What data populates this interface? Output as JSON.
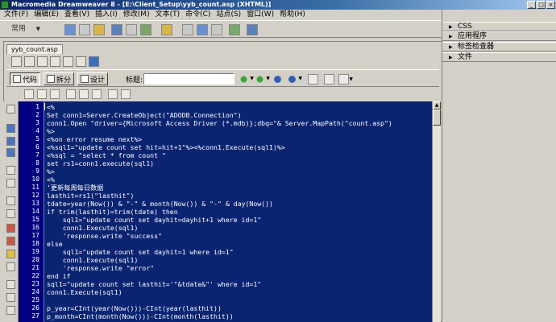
{
  "window": {
    "title": "Macromedia Dreamweaver 8 - [E:\\Client_Setup\\yyb_count.asp (XHTML)]",
    "controls": [
      "_",
      "□",
      "×"
    ]
  },
  "menu": {
    "items": [
      "文件(F)",
      "编辑(E)",
      "查看(V)",
      "插入(I)",
      "修改(M)",
      "文本(T)",
      "命令(C)",
      "站点(S)",
      "窗口(W)",
      "帮助(H)"
    ]
  },
  "insert_bar": {
    "category": "常用"
  },
  "panels": {
    "groups": [
      "CSS",
      "应用程序",
      "标签检查器",
      "文件"
    ]
  },
  "document": {
    "tab_label": "yyb_count.asp",
    "view_buttons": [
      {
        "label": "代码",
        "active": true
      },
      {
        "label": "拆分",
        "active": false
      },
      {
        "label": "设计",
        "active": false
      }
    ],
    "title_label": "标题:",
    "title_value": ""
  },
  "editor": {
    "line_numbers": [
      "1",
      "2",
      "3",
      "4",
      "5",
      "6",
      "7",
      "8",
      "9",
      "10",
      "11",
      "12",
      "13",
      "14",
      "15",
      "16",
      "17",
      "18",
      "19",
      "20",
      "21",
      "22",
      "23",
      "24",
      "25",
      "26",
      "27"
    ],
    "lines": [
      "<%",
      "Set conn1=Server.CreateObject(\"ADODB.Connection\")",
      "conn1.Open \"driver={Microsoft Access Driver (*.mdb)};dbq=\"& Server.MapPath(\"count.asp\")",
      "%>",
      "<%on error resume next%>",
      "<%sql1=\"update count set hit=hit+1\"%><%conn1.Execute(sql1)%>",
      "<%sql = \"select * from count \"",
      "set rs1=conn1.execute(sql1)",
      "%>",
      "<%",
      "'更新每周每日数据",
      "lasthit=rs1(\"lasthit\")",
      "tdate=year(Now()) & \"-\" & month(Now()) & \"-\" & day(Now())",
      "if trim(lasthit)=trim(tdate) then",
      "    sql1=\"update count set dayhit=dayhit+1 where id=1\"",
      "    conn1.Execute(sql1)",
      "    'response.write \"success\"",
      "else",
      "    sql1=\"update count set dayhit=1 where id=1\"",
      "    conn1.Execute(sql1)",
      "    'response.write \"error\"",
      "end if",
      "sql1=\"update count set lasthit='\"&tdate&\"' where id=1\"",
      "conn1.Execute(sql1)",
      "",
      "p_year=CInt(year(Now()))-CInt(year(lasthit))",
      "p_month=CInt(month(Now()))-CInt(month(lasthit))"
    ]
  }
}
